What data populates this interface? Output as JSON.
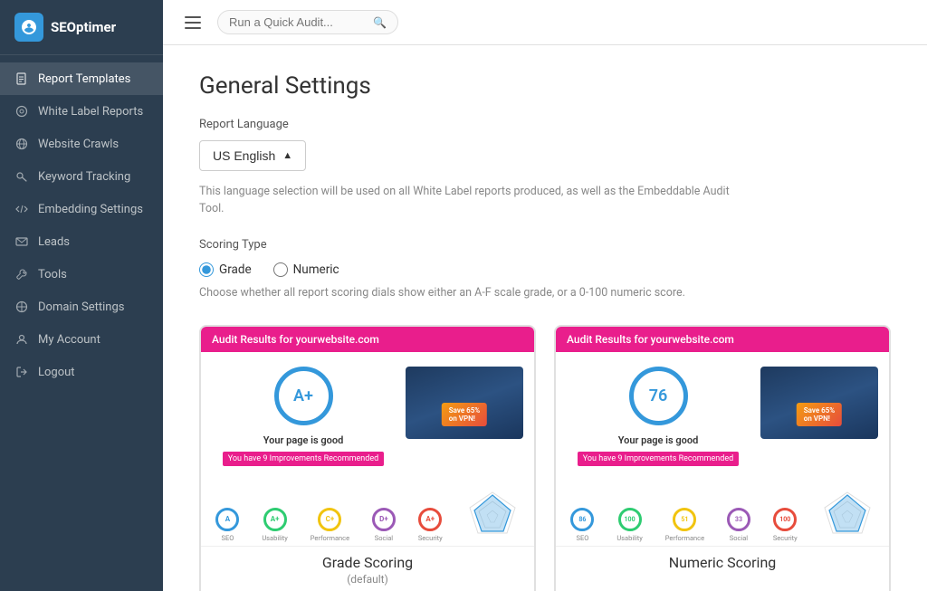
{
  "app": {
    "name": "SEOptimer"
  },
  "topbar": {
    "search_placeholder": "Run a Quick Audit..."
  },
  "sidebar": {
    "items": [
      {
        "id": "report-templates",
        "label": "Report Templates",
        "icon": "file-icon",
        "active": true
      },
      {
        "id": "white-label-reports",
        "label": "White Label Reports",
        "icon": "tag-icon",
        "active": false
      },
      {
        "id": "website-crawls",
        "label": "Website Crawls",
        "icon": "globe-icon",
        "active": false
      },
      {
        "id": "keyword-tracking",
        "label": "Keyword Tracking",
        "icon": "key-icon",
        "active": false
      },
      {
        "id": "embedding-settings",
        "label": "Embedding Settings",
        "icon": "code-icon",
        "active": false
      },
      {
        "id": "leads",
        "label": "Leads",
        "icon": "mail-icon",
        "active": false
      },
      {
        "id": "tools",
        "label": "Tools",
        "icon": "tool-icon",
        "active": false
      },
      {
        "id": "domain-settings",
        "label": "Domain Settings",
        "icon": "globe2-icon",
        "active": false
      },
      {
        "id": "my-account",
        "label": "My Account",
        "icon": "user-icon",
        "active": false
      },
      {
        "id": "logout",
        "label": "Logout",
        "icon": "logout-icon",
        "active": false
      }
    ]
  },
  "content": {
    "page_title": "General Settings",
    "report_language_label": "Report Language",
    "language_value": "US English",
    "language_arrow": "▲",
    "language_info": "This language selection will be used on all White Label reports produced, as well as the Embeddable Audit Tool.",
    "scoring_type_label": "Scoring Type",
    "scoring_info": "Choose whether all report scoring dials show either an A-F scale grade, or a 0-100 numeric score.",
    "radio_grade": "Grade",
    "radio_numeric": "Numeric",
    "grade_card": {
      "header": "Audit Results for yourwebsite.com",
      "score": "A+",
      "good_text": "Your page is good",
      "imp_text": "You have 9 Improvements Recommended",
      "mini_circles": [
        {
          "label": "SEO",
          "value": "A",
          "color": "#3498db"
        },
        {
          "label": "Usability",
          "value": "A+",
          "color": "#2ecc71"
        },
        {
          "label": "Performance",
          "value": "C+",
          "color": "#f1c40f"
        },
        {
          "label": "Social",
          "value": "D+",
          "color": "#9b59b6"
        },
        {
          "label": "Security",
          "value": "A+",
          "color": "#e74c3c"
        }
      ],
      "footer_label": "Grade Scoring",
      "footer_sub": "(default)"
    },
    "numeric_card": {
      "header": "Audit Results for yourwebsite.com",
      "score": "76",
      "good_text": "Your page is good",
      "imp_text": "You have 9 Improvements Recommended",
      "mini_circles": [
        {
          "label": "SEO",
          "value": "86",
          "color": "#3498db"
        },
        {
          "label": "Usability",
          "value": "100",
          "color": "#2ecc71"
        },
        {
          "label": "Performance",
          "value": "51",
          "color": "#f1c40f"
        },
        {
          "label": "Social",
          "value": "33",
          "color": "#9b59b6"
        },
        {
          "label": "Security",
          "value": "100",
          "color": "#e74c3c"
        }
      ],
      "footer_label": "Numeric Scoring",
      "footer_sub": ""
    }
  }
}
